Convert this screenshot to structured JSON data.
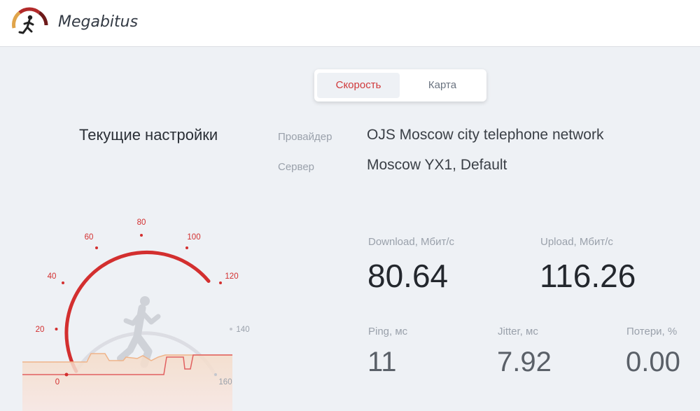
{
  "app": {
    "title": "Megabitus",
    "colors": {
      "accent": "#d32f2f",
      "background": "#eef1f5"
    }
  },
  "tabs": [
    {
      "label": "Скорость",
      "active": true
    },
    {
      "label": "Карта",
      "active": false
    }
  ],
  "settings": {
    "title": "Текущие настройки",
    "provider_label": "Провайдер",
    "provider_value": "OJS Moscow city telephone network",
    "server_label": "Сервер",
    "server_value": "Moscow YX1, Default"
  },
  "gauge": {
    "ticks": [
      "0",
      "20",
      "40",
      "60",
      "80",
      "100",
      "120",
      "140",
      "160"
    ],
    "value": 80.64,
    "max": 160
  },
  "metrics": {
    "download": {
      "label": "Download, Мбит/с",
      "value": "80.64"
    },
    "upload": {
      "label": "Upload, Мбит/с",
      "value": "116.26"
    },
    "ping": {
      "label": "Ping, мс",
      "value": "11"
    },
    "jitter": {
      "label": "Jitter, мс",
      "value": "7.92"
    },
    "loss": {
      "label": "Потери, %",
      "value": "0.00"
    }
  }
}
